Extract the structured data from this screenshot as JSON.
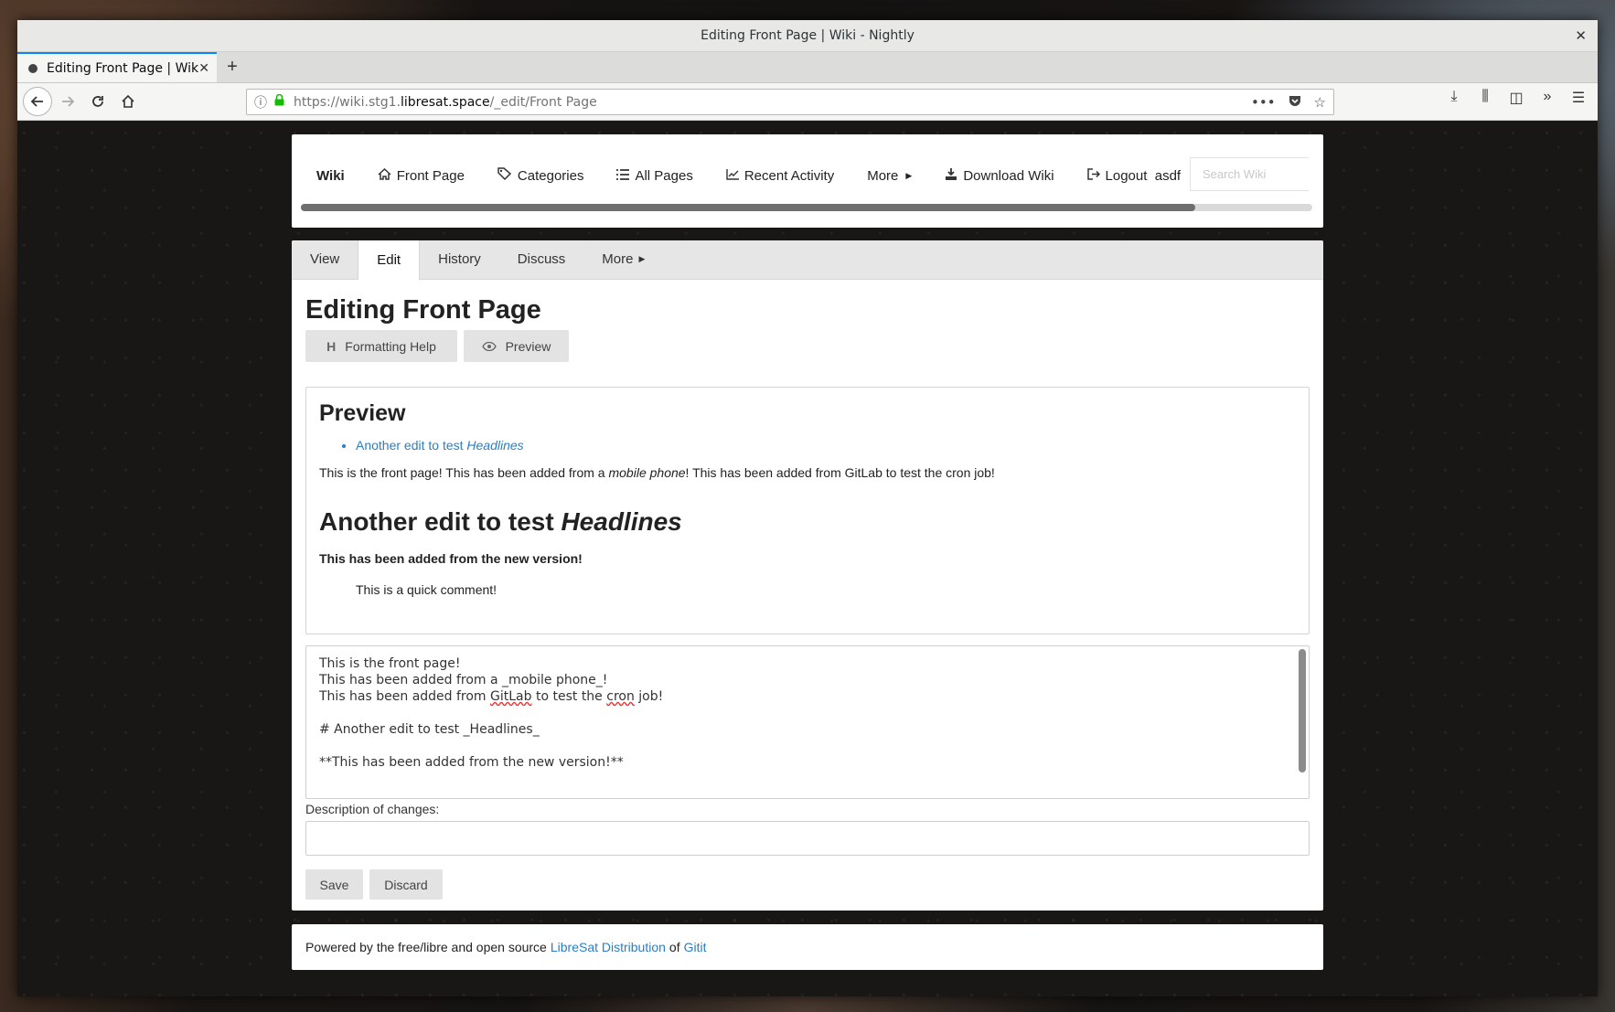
{
  "window": {
    "title": "Editing Front Page | Wiki - Nightly",
    "close_glyph": "✕"
  },
  "browser": {
    "tab_title": "Editing Front Page | Wiki",
    "tab_close": "✕",
    "new_tab": "+",
    "url_prefix": "https://wiki.stg1.",
    "url_host": "libresat.space",
    "url_path": "/_edit/Front Page"
  },
  "wiki_nav": {
    "brand": "Wiki",
    "items": [
      {
        "label": "Front Page",
        "icon": "home-icon"
      },
      {
        "label": "Categories",
        "icon": "tags-icon"
      },
      {
        "label": "All Pages",
        "icon": "list-icon"
      },
      {
        "label": "Recent Activity",
        "icon": "chart-icon"
      },
      {
        "label": "More",
        "icon": "caret-right-icon"
      },
      {
        "label": "Download Wiki",
        "icon": "download-icon"
      },
      {
        "label": "Logout  asdf",
        "icon": "logout-icon"
      }
    ],
    "search_placeholder": "Search Wiki"
  },
  "page_tabs": {
    "view": "View",
    "edit": "Edit",
    "history": "History",
    "discuss": "Discuss",
    "more": "More"
  },
  "page": {
    "title": "Editing Front Page",
    "formatting_help": "Formatting Help",
    "preview_button": "Preview"
  },
  "preview": {
    "heading": "Preview",
    "toc_link_text": "Another edit to test ",
    "toc_link_em": "Headlines",
    "para_part1": "This is the front page! This has been added from a ",
    "para_em": "mobile phone",
    "para_part2": "! This has been added from GitLab to test the cron job!",
    "h1_text": "Another edit to test ",
    "h1_em": "Headlines",
    "bold_line": "This has been added from the new version!",
    "quote": "This is a quick comment!"
  },
  "editor": {
    "line1": "This is the front page!",
    "line2": "This has been added from a _mobile phone_!",
    "line3a": "This has been added from ",
    "line3_gitlab": "GitLab",
    "line3b": " to test the ",
    "line3_cron": "cron",
    "line3c": " job!",
    "line5": "# Another edit to test _Headlines_",
    "line7": "**This has been added from the new version!**"
  },
  "form": {
    "description_label": "Description of changes:",
    "description_value": "",
    "save": "Save",
    "discard": "Discard"
  },
  "footer": {
    "text1": "Powered by the free/libre and open source",
    "link1": "LibreSat Distribution",
    "text2": "of",
    "link2": "Gitit"
  },
  "colors": {
    "link": "#2a7ec5",
    "tab_highlight": "#0a84ff",
    "secure_lock": "#12bc00"
  }
}
